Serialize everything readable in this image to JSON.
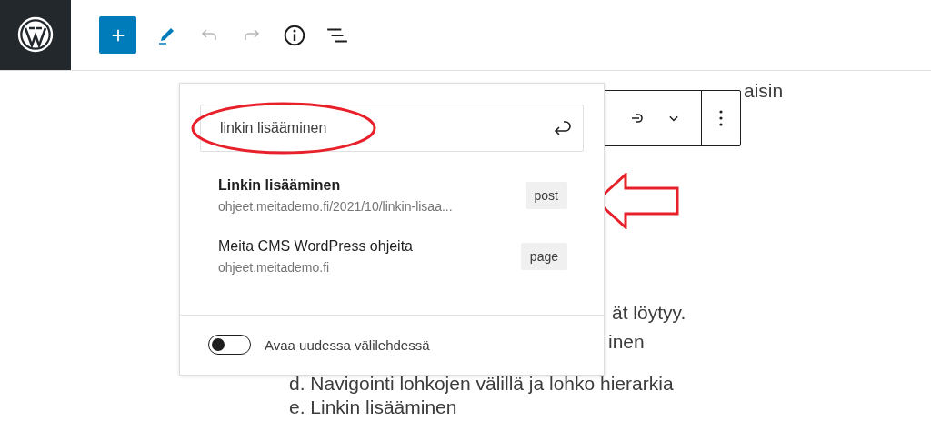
{
  "top_toolbar": [
    {
      "kind": "add",
      "disabled": false
    },
    {
      "kind": "edit",
      "disabled": false
    },
    {
      "kind": "undo",
      "disabled": true
    },
    {
      "kind": "redo",
      "disabled": true
    },
    {
      "kind": "info",
      "disabled": false
    },
    {
      "kind": "outline",
      "disabled": false
    }
  ],
  "content_lines": [
    {
      "text": "aisin",
      "kind": "fragment_top"
    },
    {
      "text": "ät löytyy.",
      "kind": "fragment_a"
    },
    {
      "text": "inen",
      "kind": "fragment_b"
    },
    {
      "text": "d. Navigointi lohkojen välillä ja lohko hierarkia",
      "kind": "item"
    },
    {
      "text": "e. Linkin lisääminen",
      "kind": "item"
    }
  ],
  "link_popover": {
    "search": {
      "value": "linkin lisääminen"
    },
    "results": [
      {
        "title": "Linkin lisääminen",
        "url": "ohjeet.meitademo.fi/2021/10/linkin-lisaa...",
        "type": "post"
      },
      {
        "title": "Meita CMS WordPress ohjeita",
        "url": "ohjeet.meitademo.fi",
        "type": "page"
      }
    ],
    "new_tab_toggle": {
      "label": "Avaa uudessa välilehdessä",
      "on": false
    }
  }
}
